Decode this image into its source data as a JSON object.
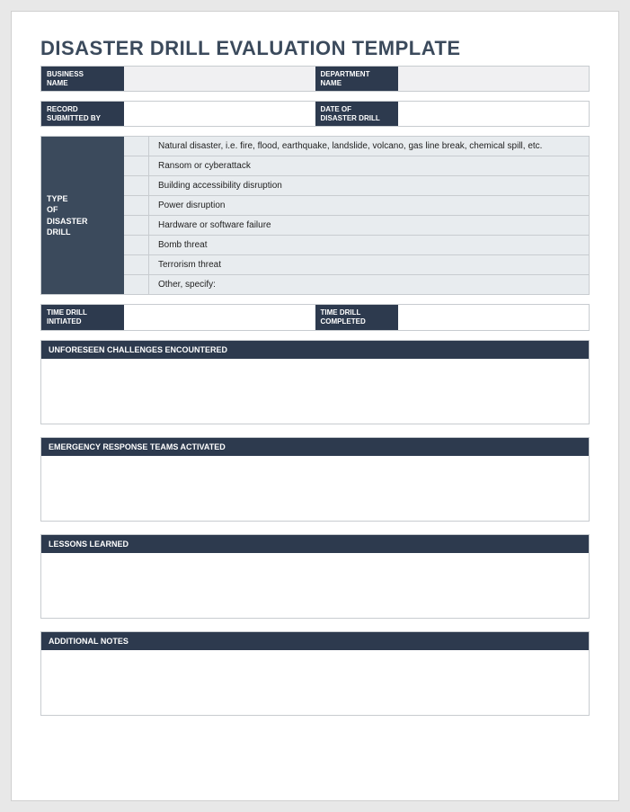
{
  "title": "DISASTER DRILL EVALUATION TEMPLATE",
  "row1": {
    "label1": "BUSINESS\nNAME",
    "val1": "",
    "label2": "DEPARTMENT\nNAME",
    "val2": ""
  },
  "row2": {
    "label1": "RECORD\nSUBMITTED BY",
    "val1": "",
    "label2": "DATE OF\nDISASTER DRILL",
    "val2": ""
  },
  "drill": {
    "label": "TYPE\nOF\nDISASTER\nDRILL",
    "options": [
      "Natural disaster, i.e. fire, flood, earthquake, landslide, volcano, gas line break, chemical spill, etc.",
      "Ransom or cyberattack",
      "Building accessibility disruption",
      "Power disruption",
      "Hardware or software failure",
      "Bomb threat",
      "Terrorism threat",
      "Other, specify:"
    ]
  },
  "row3": {
    "label1": "TIME DRILL\nINITIATED",
    "val1": "",
    "label2": "TIME DRILL\nCOMPLETED",
    "val2": ""
  },
  "sections": [
    {
      "header": "UNFORESEEN CHALLENGES ENCOUNTERED",
      "body": ""
    },
    {
      "header": "EMERGENCY RESPONSE TEAMS ACTIVATED",
      "body": ""
    },
    {
      "header": "LESSONS LEARNED",
      "body": ""
    },
    {
      "header": "ADDITIONAL NOTES",
      "body": ""
    }
  ]
}
